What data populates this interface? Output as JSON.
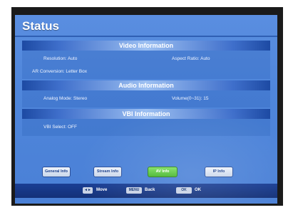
{
  "screen": {
    "title": "Status"
  },
  "sections": {
    "video": {
      "header": "Video Information",
      "resolution": "Resolution: Auto",
      "aspect_ratio": "Aspect Ratio: Auto",
      "ar_conversion": "AR Conversion: Letter Box"
    },
    "audio": {
      "header": "Audio Information",
      "analog_mode": "Analog Mode: Stereo",
      "volume": "Volume(0~31): 15"
    },
    "vbi": {
      "header": "VBI Information",
      "vbi_select": "VBI Select: OFF"
    }
  },
  "buttons": {
    "general_info": "General Info",
    "stream_info": "Stream Info",
    "av_info": "AV Info",
    "ip_info": "IP Info"
  },
  "footer": {
    "move_key": "◄►",
    "move_label": "Move",
    "back_key": "MENU",
    "back_label": "Back",
    "ok_key": "OK",
    "ok_label": "OK"
  },
  "colors": {
    "background": "#4f86db",
    "header_band": "#9dc0f2",
    "active_button": "#45b52c",
    "footer_bar": "#143178"
  }
}
